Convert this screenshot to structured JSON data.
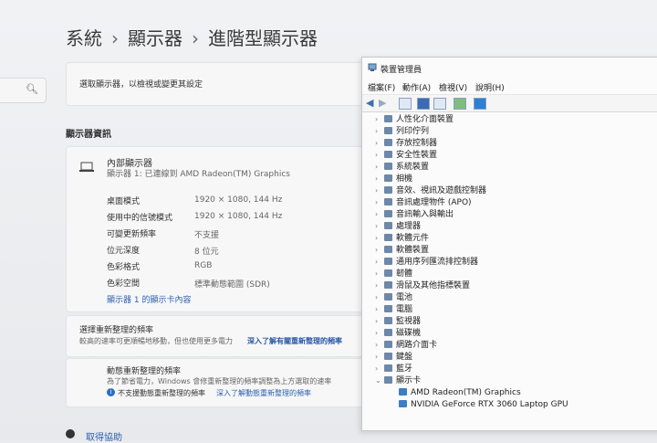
{
  "breadcrumb": [
    "系統",
    "顯示器",
    "進階型顯示器"
  ],
  "select_display": {
    "label": "選取顯示器，以檢視或變更其設定"
  },
  "display_info": {
    "section_title": "顯示器資訊",
    "device_title": "內部顯示器",
    "device_sub": "顯示器 1: 已連線到 AMD Radeon(TM) Graphics",
    "rows": [
      {
        "label": "桌面模式",
        "value": "1920 × 1080, 144 Hz"
      },
      {
        "label": "使用中的信號模式",
        "value": "1920 × 1080, 144 Hz"
      },
      {
        "label": "可變更新頻率",
        "value": "不支援"
      },
      {
        "label": "位元深度",
        "value": "8 位元"
      },
      {
        "label": "色彩格式",
        "value": "RGB"
      },
      {
        "label": "色彩空間",
        "value": "標準動態範圍 (SDR)"
      }
    ],
    "adapter_link": "顯示器 1 的顯示卡內容"
  },
  "refresh": {
    "title": "選擇重新整理的頻率",
    "desc": "較高的速率可更順暢地移動，但也使用更多電力",
    "link": "深入了解有關重新整理的頻率"
  },
  "dynamic_refresh": {
    "title": "動態重新整理的頻率",
    "desc": "為了節省電力，Windows 會修重新整理的頻率調整為上方選取的速率",
    "info": "不支援動態重新整理的頻率",
    "link": "深入了解動態重新整理的頻率"
  },
  "help": {
    "label": "取得協助"
  },
  "device_manager": {
    "title": "裝置管理員",
    "menus": [
      "檔案(F)",
      "動作(A)",
      "檢視(V)",
      "說明(H)"
    ],
    "categories": [
      "人性化介面裝置",
      "列印佇列",
      "存放控制器",
      "安全性裝置",
      "系統裝置",
      "相機",
      "音效、視訊及遊戲控制器",
      "音訊處理物件 (APO)",
      "音訊輸入與輸出",
      "處理器",
      "軟體元件",
      "軟體裝置",
      "通用序列匯流排控制器",
      "韌體",
      "滑鼠及其他指標裝置",
      "電池",
      "電腦",
      "監視器",
      "磁碟機",
      "網路介面卡",
      "鍵盤",
      "藍牙",
      "顯示卡"
    ],
    "gpus": [
      "AMD Radeon(TM) Graphics",
      "NVIDIA GeForce RTX 3060 Laptop GPU"
    ]
  }
}
